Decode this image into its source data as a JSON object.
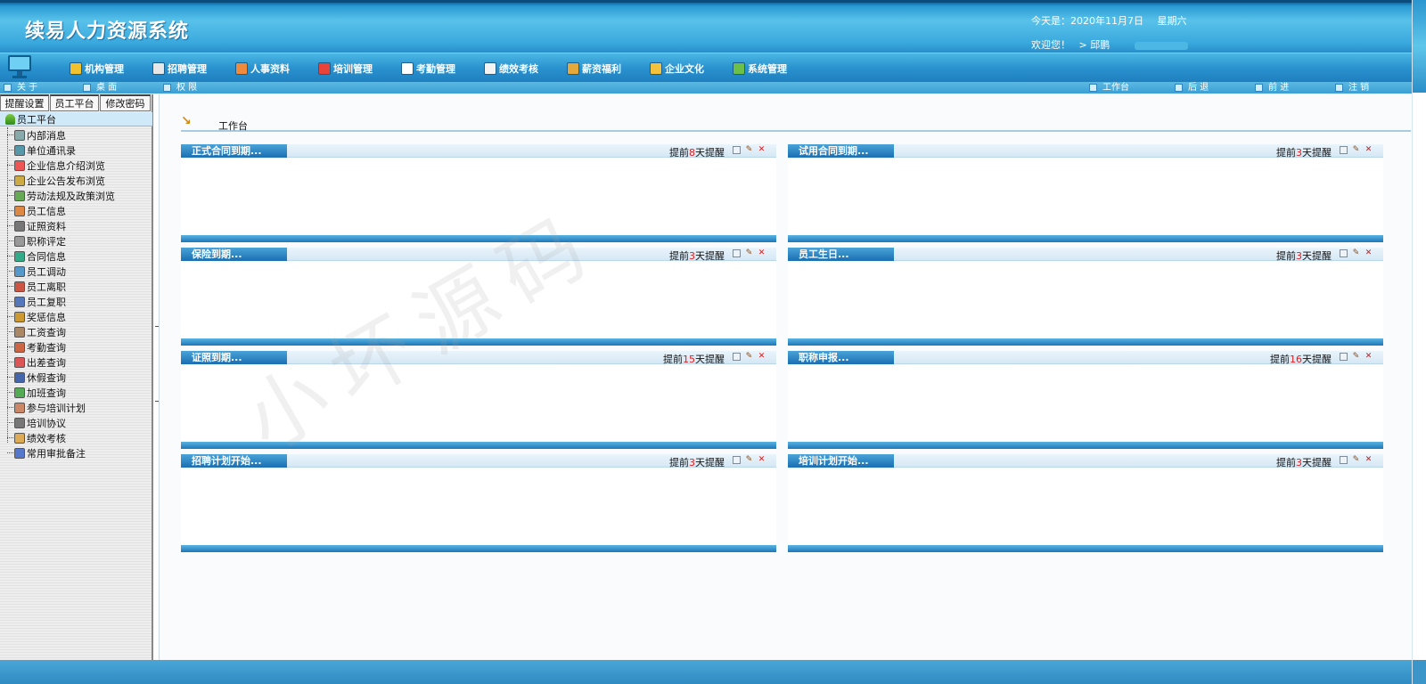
{
  "header": {
    "app_title": "续易人力资源系统",
    "date_label": "今天是：2020年11月7日",
    "weekday": "星期六",
    "welcome": "欢迎您！",
    "user_prefix": "> 邱鹏"
  },
  "mainnav": {
    "items": [
      {
        "label": "机构管理",
        "icon": "organization-icon",
        "color": "#f2c12e"
      },
      {
        "label": "招聘管理",
        "icon": "recruit-icon",
        "color": "#e7e7e7"
      },
      {
        "label": "人事资料",
        "icon": "personnel-icon",
        "color": "#f08a3c"
      },
      {
        "label": "培训管理",
        "icon": "training-icon",
        "color": "#e8443a"
      },
      {
        "label": "考勤管理",
        "icon": "attendance-icon",
        "color": "#ffffff"
      },
      {
        "label": "绩效考核",
        "icon": "performance-icon",
        "color": "#f3f3f3"
      },
      {
        "label": "薪资福利",
        "icon": "salary-icon",
        "color": "#e5a83a"
      },
      {
        "label": "企业文化",
        "icon": "culture-icon",
        "color": "#f2c23c"
      },
      {
        "label": "系统管理",
        "icon": "system-icon",
        "color": "#6cc04a"
      }
    ]
  },
  "subbar": {
    "about": "关 于",
    "desktop": "桌 面",
    "permissions": "权 限",
    "workbench": "工作台",
    "back": "后 退",
    "forward": "前 进",
    "logout": "注 销"
  },
  "left": {
    "tabs": [
      "提醒设置",
      "员工平台",
      "修改密码"
    ],
    "tree_root": "员工平台",
    "tree_items": [
      {
        "label": "内部消息",
        "icon": "message-icon"
      },
      {
        "label": "单位通讯录",
        "icon": "address-book-icon"
      },
      {
        "label": "企业信息介绍浏览",
        "icon": "info-icon"
      },
      {
        "label": "企业公告发布浏览",
        "icon": "notice-icon"
      },
      {
        "label": "劳动法规及政策浏览",
        "icon": "law-icon"
      },
      {
        "label": "员工信息",
        "icon": "employee-icon"
      },
      {
        "label": "证照资料",
        "icon": "license-icon"
      },
      {
        "label": "职称评定",
        "icon": "title-icon"
      },
      {
        "label": "合同信息",
        "icon": "contract-icon"
      },
      {
        "label": "员工调动",
        "icon": "transfer-icon"
      },
      {
        "label": "员工离职",
        "icon": "resign-icon"
      },
      {
        "label": "员工复职",
        "icon": "reinstate-icon"
      },
      {
        "label": "奖惩信息",
        "icon": "reward-icon"
      },
      {
        "label": "工资查询",
        "icon": "wage-icon"
      },
      {
        "label": "考勤查询",
        "icon": "attendance-query-icon"
      },
      {
        "label": "出差查询",
        "icon": "trip-icon"
      },
      {
        "label": "休假查询",
        "icon": "leave-icon"
      },
      {
        "label": "加班查询",
        "icon": "overtime-icon"
      },
      {
        "label": "参与培训计划",
        "icon": "training-plan-icon"
      },
      {
        "label": "培训协议",
        "icon": "agreement-icon"
      },
      {
        "label": "绩效考核",
        "icon": "appraisal-icon"
      },
      {
        "label": "常用审批备注",
        "icon": "approval-icon"
      }
    ]
  },
  "content": {
    "breadcrumb": "工作台",
    "panels": [
      {
        "title": "正式合同到期...",
        "remind_pre": "提前",
        "days": "8",
        "remind_post": "天提醒"
      },
      {
        "title": "试用合同到期...",
        "remind_pre": "提前",
        "days": "3",
        "remind_post": "天提醒"
      },
      {
        "title": "保险到期...",
        "remind_pre": "提前",
        "days": "3",
        "remind_post": "天提醒"
      },
      {
        "title": "员工生日...",
        "remind_pre": "提前",
        "days": "3",
        "remind_post": "天提醒"
      },
      {
        "title": "证照到期...",
        "remind_pre": "提前",
        "days": "15",
        "remind_post": "天提醒"
      },
      {
        "title": "职称申报...",
        "remind_pre": "提前",
        "days": "16",
        "remind_post": "天提醒"
      },
      {
        "title": "招聘计划开始...",
        "remind_pre": "提前",
        "days": "3",
        "remind_post": "天提醒"
      },
      {
        "title": "培训计划开始...",
        "remind_pre": "提前",
        "days": "3",
        "remind_post": "天提醒"
      }
    ]
  },
  "watermark": "小坏源码",
  "colors": {
    "accent": "#2a93cf",
    "remind_number": "#e21c1c",
    "panel_title": "#1a6fb1"
  }
}
